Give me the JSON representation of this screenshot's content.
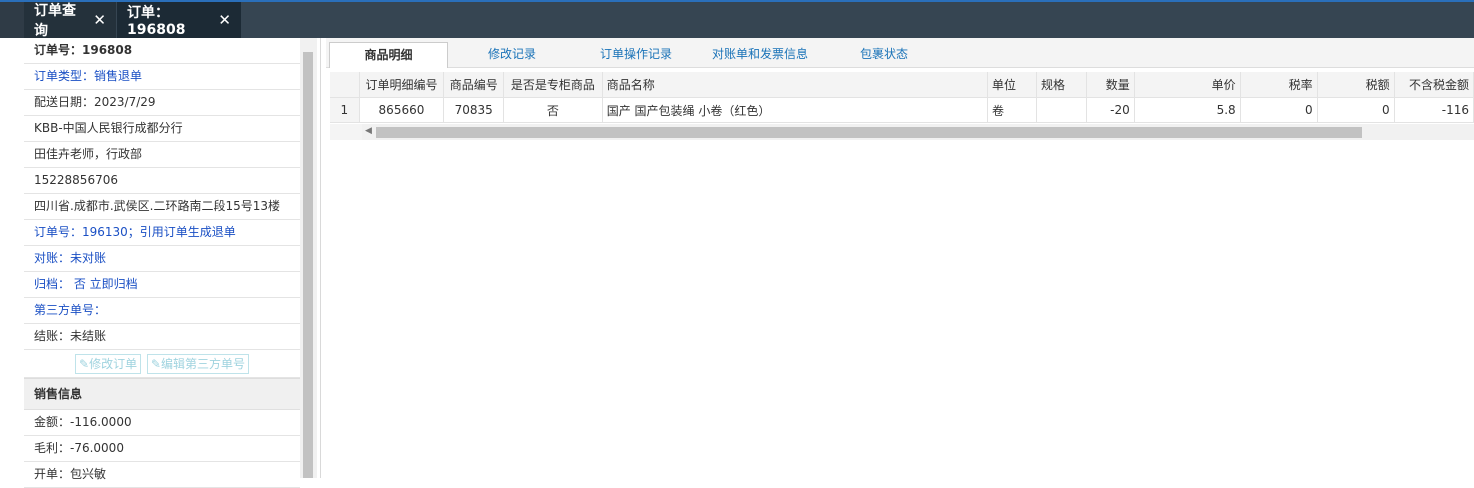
{
  "tabs": [
    {
      "label": "订单查询"
    },
    {
      "label": "订单：196808"
    }
  ],
  "left_panel": {
    "order_no": "订单号：196808",
    "order_type": "订单类型：销售退单",
    "delivery_date": "配送日期：2023/7/29",
    "customer": "KBB-中国人民银行成都分行",
    "contact": "田佳卉老师，行政部",
    "phone": "15228856706",
    "address": "四川省.成都市.武侯区.二环路南二段15号13楼",
    "ref_order": "订单号：196130；引用订单生成退单",
    "reconcile": "对账：未对账",
    "archive": "归档： 否 立即归档",
    "third_party": "第三方单号：",
    "settle": "结账：未结账",
    "btn_edit_order": "修改订单",
    "btn_edit_third": "编辑第三方单号",
    "sales_section": "销售信息",
    "amount": "金额：-116.0000",
    "profit": "毛利：-76.0000",
    "clipped": "开单：包兴敏"
  },
  "subtabs": [
    {
      "label": "商品明细"
    },
    {
      "label": "修改记录"
    },
    {
      "label": "订单操作记录"
    },
    {
      "label": "对账单和发票信息"
    },
    {
      "label": "包裹状态"
    }
  ],
  "table": {
    "headers": [
      "",
      "订单明细编号",
      "商品编号",
      "是否是专柜商品",
      "商品名称",
      "单位",
      "规格",
      "数量",
      "单价",
      "税率",
      "税额",
      "不含税金额"
    ],
    "rows": [
      [
        "1",
        "865660",
        "70835",
        "否",
        "国产 国产包装绳 小卷（红色）",
        "卷",
        "",
        "-20",
        "5.8",
        "0",
        "0",
        "-116"
      ]
    ]
  },
  "colors": {
    "accent": "#2a6fba",
    "link": "#1a4fc4",
    "tabbar": "#364552"
  }
}
